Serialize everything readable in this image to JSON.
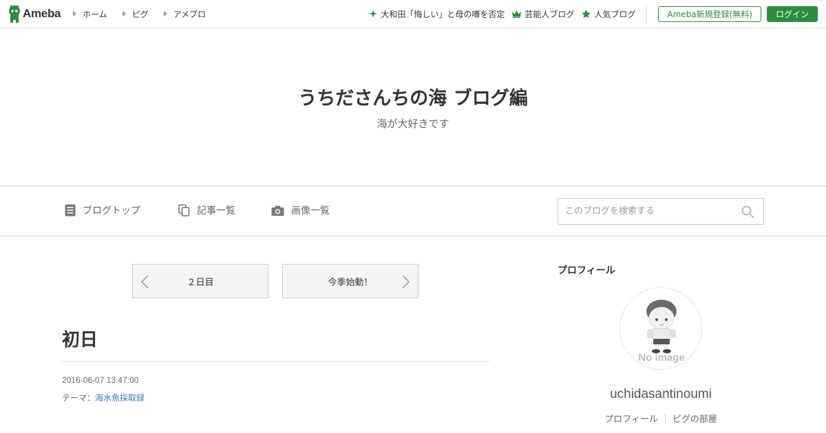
{
  "header": {
    "logo_text": "Ameba",
    "nav": [
      {
        "label": "ホーム"
      },
      {
        "label": "ピグ"
      },
      {
        "label": "アメブロ"
      }
    ],
    "news": [
      {
        "label": "大和田「悔しい」と母の噂を否定",
        "icon": "sparkle-icon"
      },
      {
        "label": "芸能人ブログ",
        "icon": "crown-icon"
      },
      {
        "label": "人気ブログ",
        "icon": "star-icon"
      }
    ],
    "register_label": "Ameba新規登録(無料)",
    "login_label": "ログイン"
  },
  "blog": {
    "title": "うちださんちの海 ブログ編",
    "description": "海が大好きです"
  },
  "blog_nav": {
    "items": [
      {
        "label": "ブログトップ",
        "icon": "document-icon"
      },
      {
        "label": "記事一覧",
        "icon": "copy-icon"
      },
      {
        "label": "画像一覧",
        "icon": "camera-icon"
      }
    ],
    "search_placeholder": "このブログを検索する"
  },
  "pager": {
    "prev_label": "２日目",
    "next_label": "今季始動！"
  },
  "entry": {
    "title": "初日",
    "date": "2016-06-07 13:47:00",
    "theme_prefix": "テーマ：",
    "theme_link": "海水魚採取録"
  },
  "sidebar": {
    "heading": "プロフィール",
    "avatar_text": "No image",
    "username": "uchidasantinoumi",
    "links": [
      {
        "label": "プロフィール"
      },
      {
        "label": "ピグの部屋"
      }
    ]
  },
  "colors": {
    "brand_green": "#2d8c3c",
    "link_blue": "#3a7fc1"
  }
}
